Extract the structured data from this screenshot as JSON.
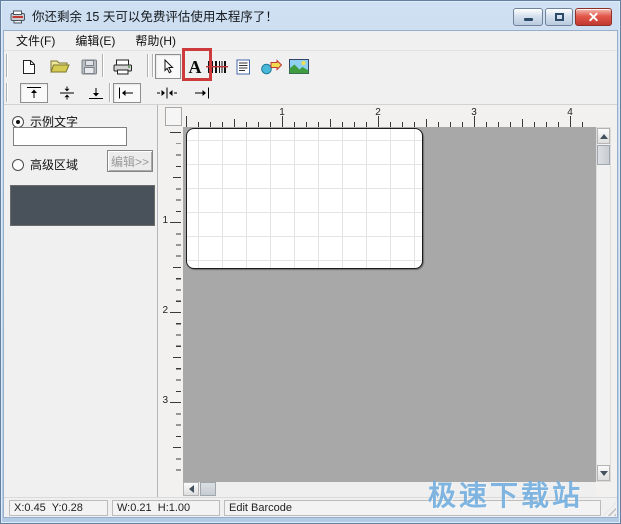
{
  "window": {
    "title": "你还剩余 15 天可以免费评估使用本程序了！"
  },
  "menu": {
    "items": [
      {
        "label": "文件(F)"
      },
      {
        "label": "编辑(E)"
      },
      {
        "label": "帮助(H)"
      }
    ]
  },
  "toolbar": {
    "text_tool_label": "A",
    "icons": [
      "new-document-icon",
      "open-folder-icon",
      "save-icon",
      "print-icon",
      "select-cursor-icon",
      "text-tool-icon",
      "barcode-tool-icon",
      "text-block-tool-icon",
      "shape-tool-icon",
      "image-tool-icon"
    ],
    "align_icons": [
      "align-top-icon",
      "align-middle-icon",
      "align-bottom-icon",
      "align-left-icon",
      "align-center-icon",
      "align-right-icon"
    ]
  },
  "side_panel": {
    "sample_text_label": "示例文字",
    "sample_text_value": "",
    "advanced_area_label": "高级区域",
    "edit_button_label": "编辑>>"
  },
  "rulers": {
    "horizontal": [
      "1",
      "2",
      "3",
      "4"
    ],
    "vertical": [
      "1",
      "2",
      "3"
    ]
  },
  "status_bar": {
    "position": "X:0.45  Y:0.28",
    "dimensions": "W:0.21  H:1.00",
    "mode": "Edit Barcode"
  },
  "watermark": {
    "text": "极速下载站",
    "color": "#6aa9dc"
  },
  "annotation": {
    "highlight_color": "#cd3a3c"
  },
  "colors": {
    "canvas_background": "#a8a8a8",
    "preview_box": "#49525a",
    "frame": "#b3cbe4"
  }
}
